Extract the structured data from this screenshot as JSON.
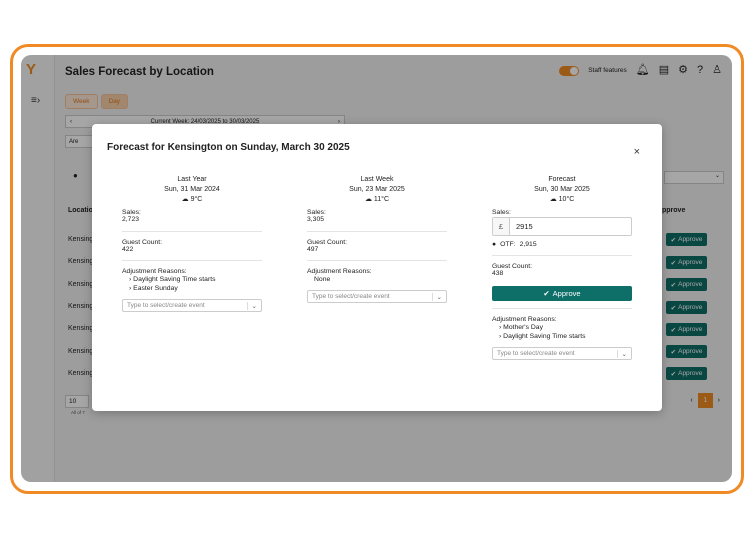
{
  "header": {
    "title": "Sales Forecast by Location",
    "staff_features": "Staff features"
  },
  "icons": {
    "logo": "logo-icon",
    "collapse": "collapse-sidebar-icon",
    "bell": "bell-icon",
    "document": "document-icon",
    "settings": "gear-icon",
    "help": "help-icon",
    "user": "user-icon"
  },
  "tabs": [
    "Week",
    "Day"
  ],
  "week_nav": {
    "prev": "‹",
    "label": "Current Week: 24/03/2025 to 30/03/2025",
    "next": "›"
  },
  "area_button": "Are",
  "table": {
    "column_location": "Location",
    "column_approve": "pprove",
    "rows": [
      "Kensing",
      "Kensing",
      "Kensing",
      "Kensing",
      "Kensing",
      "Kensing",
      "Kensing"
    ],
    "approve_label": "Approve"
  },
  "pagination": {
    "page_size": "10",
    "all_of": "All of 7",
    "current_page": "1"
  },
  "modal": {
    "title": "Forecast for Kensington on Sunday, March 30 2025",
    "close": "×",
    "last_year": {
      "heading": "Last Year",
      "date": "Sun, 31 Mar 2024",
      "temp": "9°C",
      "sales_label": "Sales:",
      "sales": "2,723",
      "guest_label": "Guest Count:",
      "guest": "422",
      "reasons_label": "Adjustment Reasons:",
      "reasons": [
        "Daylight Saving Time starts",
        "Easter Sunday"
      ],
      "select_placeholder": "Type to select/create event"
    },
    "last_week": {
      "heading": "Last Week",
      "date": "Sun, 23 Mar 2025",
      "temp": "11°C",
      "sales_label": "Sales:",
      "sales": "3,305",
      "guest_label": "Guest Count:",
      "guest": "497",
      "reasons_label": "Adjustment Reasons:",
      "none": "None",
      "select_placeholder": "Type to select/create event"
    },
    "forecast": {
      "heading": "Forecast",
      "date": "Sun, 30 Mar 2025",
      "temp": "10°C",
      "sales_label": "Sales:",
      "currency": "£",
      "sales_value": "2915",
      "otf_label": "OTF:",
      "otf_value": "2,915",
      "guest_label": "Guest Count:",
      "guest": "438",
      "approve": "Approve",
      "reasons_label": "Adjustment Reasons:",
      "reasons": [
        "Mother's Day",
        "Daylight Saving Time starts"
      ],
      "select_placeholder": "Type to select/create event"
    }
  },
  "colors": {
    "accent": "#f08a24",
    "approve": "#0e6e68"
  }
}
